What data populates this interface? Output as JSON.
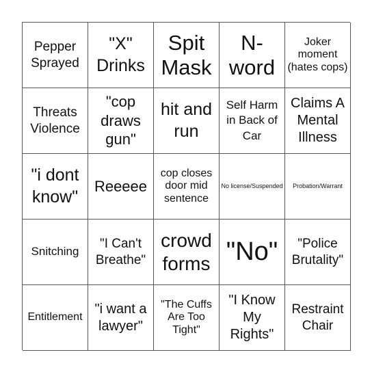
{
  "board": {
    "cells": [
      {
        "text": "Pepper Sprayed",
        "size": "fs19"
      },
      {
        "text": "\"X\" Drinks",
        "size": "fs25"
      },
      {
        "text": "Spit Mask",
        "size": "fs31"
      },
      {
        "text": "N- word",
        "size": "fs31"
      },
      {
        "text": "Joker moment (hates cops)",
        "size": "fs16"
      },
      {
        "text": "Threats Violence",
        "size": "fs19"
      },
      {
        "text": "\"cop draws gun\"",
        "size": "fs22"
      },
      {
        "text": "hit and run",
        "size": "fs25"
      },
      {
        "text": "Self Harm in Back of Car",
        "size": "fs17"
      },
      {
        "text": "Claims A Mental Illness",
        "size": "fs20"
      },
      {
        "text": "\"i dont know\"",
        "size": "fs25"
      },
      {
        "text": "Reeeee",
        "size": "fs22"
      },
      {
        "text": "cop closes door mid sentence",
        "size": "fs16"
      },
      {
        "text": "No license/Suspended",
        "size": "fs9"
      },
      {
        "text": "Probation/Warrant",
        "size": "fs9"
      },
      {
        "text": "Snitching",
        "size": "fs17"
      },
      {
        "text": "\"I Can't Breathe\"",
        "size": "fs19"
      },
      {
        "text": "crowd forms",
        "size": "fs28"
      },
      {
        "text": "\"No\"",
        "size": "fs36"
      },
      {
        "text": "\"Police Brutality\"",
        "size": "fs19"
      },
      {
        "text": "Entitlement",
        "size": "fs16"
      },
      {
        "text": "\"i want a lawyer\"",
        "size": "fs20"
      },
      {
        "text": "\"The Cuffs Are Too Tight\"",
        "size": "fs16"
      },
      {
        "text": "\"I Know My Rights\"",
        "size": "fs20"
      },
      {
        "text": "Restraint Chair",
        "size": "fs19"
      }
    ]
  }
}
